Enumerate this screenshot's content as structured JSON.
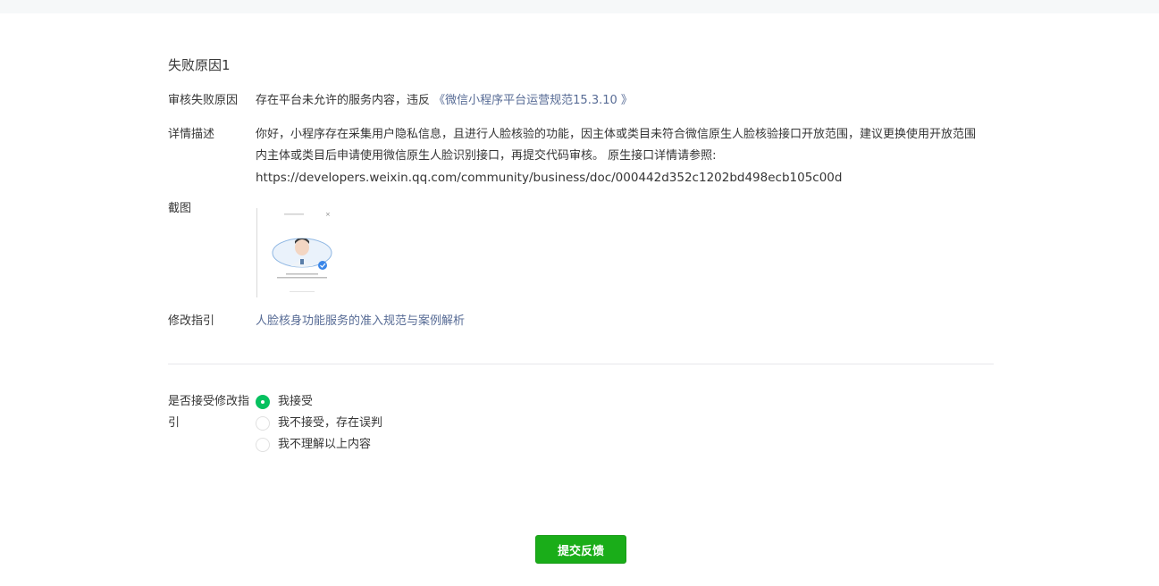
{
  "section_title": "失败原因1",
  "reason": {
    "label": "审核失败原因",
    "text": "存在平台未允许的服务内容，违反",
    "link": "《微信小程序平台运营规范15.3.10 》"
  },
  "detail": {
    "label": "详情描述",
    "text": "你好，小程序存在采集用户隐私信息，且进行人脸核验的功能，因主体或类目未符合微信原生人脸核验接口开放范围，建议更换使用开放范围内主体或类目后申请使用微信原生人脸识别接口，再提交代码审核。 原生接口详情请参照:",
    "url": "https://developers.weixin.qq.com/community/business/doc/000442d352c1202bd498ecb105c00d"
  },
  "screenshot": {
    "label": "截图"
  },
  "guide": {
    "label": "修改指引",
    "link": "人脸核身功能服务的准入规范与案例解析"
  },
  "accept": {
    "label": "是否接受修改指引",
    "options": [
      {
        "label": "我接受",
        "checked": true
      },
      {
        "label": "我不接受，存在误判",
        "checked": false
      },
      {
        "label": "我不理解以上内容",
        "checked": false
      }
    ]
  },
  "submit_label": "提交反馈",
  "colors": {
    "link": "#576b95",
    "primary_green": "#1aad19",
    "radio_green": "#07c160"
  }
}
